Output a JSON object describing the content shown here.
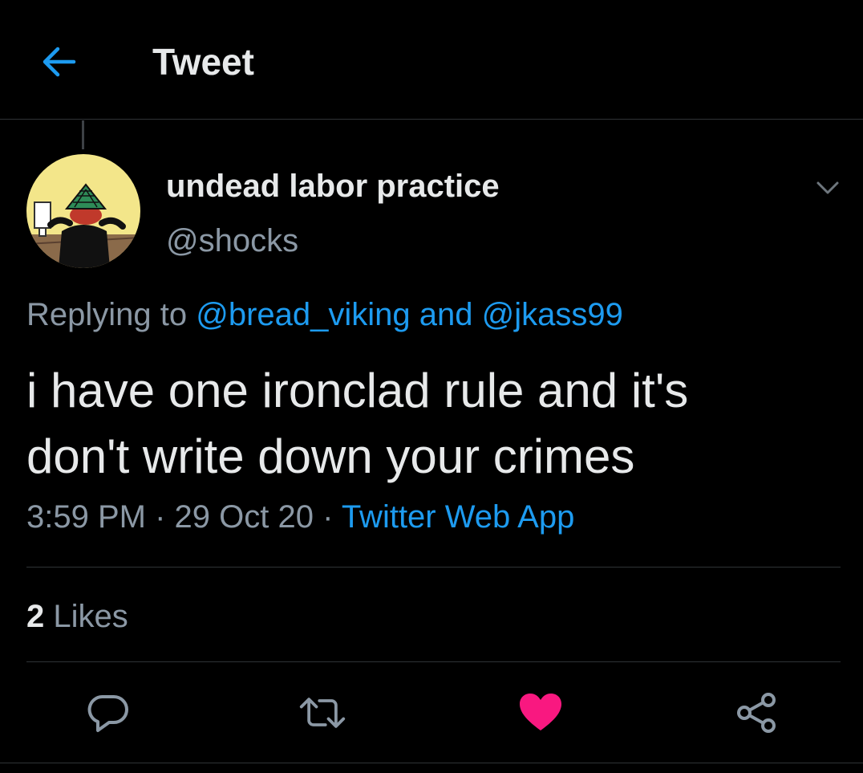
{
  "header": {
    "title": "Tweet",
    "back_icon": "arrow-left-icon"
  },
  "tweet": {
    "display_name": "undead labor practice",
    "handle": "@shocks",
    "replying_prefix": "Replying to",
    "reply_user_1": "@bread_viking",
    "reply_and": "and",
    "reply_user_2": "@jkass99",
    "text": "i have one ironclad rule and it's\ndon't write down your crimes",
    "time": "3:59 PM",
    "dot": "·",
    "date": "29 Oct 20",
    "source": "Twitter Web App",
    "likes_count": "2",
    "likes_label": "Likes",
    "liked": true
  },
  "actions": {
    "reply_icon": "reply-icon",
    "retweet_icon": "retweet-icon",
    "like_icon": "heart-icon",
    "share_icon": "share-icon"
  },
  "colors": {
    "background": "#000000",
    "accent": "#1d9bf0",
    "like": "#f91880",
    "text_primary": "#e7e9ea",
    "text_secondary": "#8b98a5",
    "divider": "#2f3336"
  }
}
